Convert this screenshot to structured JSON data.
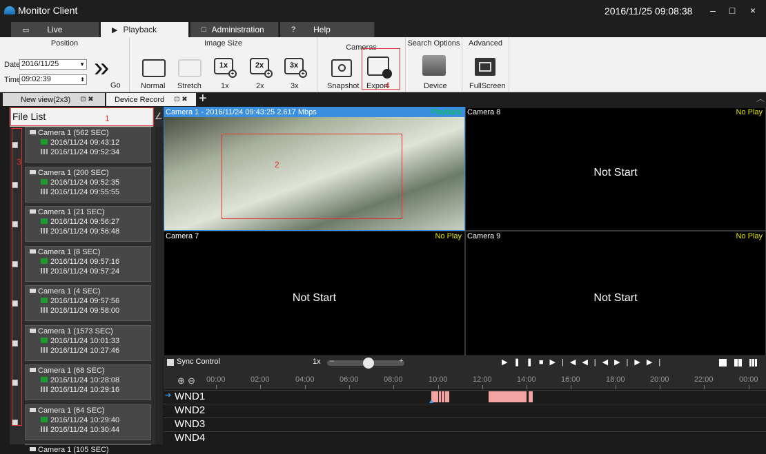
{
  "window": {
    "title": "Monitor Client",
    "datetime": "2016/11/25 09:08:38",
    "minimize": "–",
    "maximize": "□",
    "close": "×"
  },
  "main_tabs": [
    {
      "label": "Live"
    },
    {
      "label": "Playback"
    },
    {
      "label": "Administration"
    },
    {
      "label": "Help"
    }
  ],
  "ribbon": {
    "position": {
      "title": "Position",
      "date_label": "Date",
      "date_value": "2016/11/25",
      "time_label": "Time",
      "time_value": "09:02:39",
      "go_label": "Go"
    },
    "image_size": {
      "title": "Image Size",
      "normal": "Normal",
      "stretch": "Stretch",
      "z1": "1x",
      "z2": "2x",
      "z3": "3x"
    },
    "cameras": {
      "title": "Cameras",
      "snapshot": "Snapshot",
      "export": "Export"
    },
    "search": {
      "title": "Search Options",
      "device": "Device"
    },
    "advanced": {
      "title": "Advanced",
      "fullscreen": "FullScreen"
    }
  },
  "view_tabs": [
    {
      "label": "New view(2x3)"
    },
    {
      "label": "Device Record"
    }
  ],
  "file_list": {
    "title": "File List",
    "records": [
      {
        "title": "Camera 1  (562 SEC)",
        "start": "2016/11/24 09:43:12",
        "end": "2016/11/24 09:52:34"
      },
      {
        "title": "Camera 1  (200 SEC)",
        "start": "2016/11/24 09:52:35",
        "end": "2016/11/24 09:55:55"
      },
      {
        "title": "Camera 1  (21 SEC)",
        "start": "2016/11/24 09:56:27",
        "end": "2016/11/24 09:56:48"
      },
      {
        "title": "Camera 1  (8 SEC)",
        "start": "2016/11/24 09:57:16",
        "end": "2016/11/24 09:57:24"
      },
      {
        "title": "Camera 1  (4 SEC)",
        "start": "2016/11/24 09:57:56",
        "end": "2016/11/24 09:58:00"
      },
      {
        "title": "Camera 1  (1573 SEC)",
        "start": "2016/11/24 10:01:33",
        "end": "2016/11/24 10:27:46"
      },
      {
        "title": "Camera 1  (68 SEC)",
        "start": "2016/11/24 10:28:08",
        "end": "2016/11/24 10:29:16"
      },
      {
        "title": "Camera 1  (64 SEC)",
        "start": "2016/11/24 10:29:40",
        "end": "2016/11/24 10:30:44"
      },
      {
        "title": "Camera 1  (105 SEC)",
        "start": "",
        "end": ""
      }
    ]
  },
  "panes": [
    {
      "label": "Camera 1 - 2016/11/24 09:43:25 2.617 Mbps",
      "status": "Playback",
      "status_color": "#00cc44",
      "center": ""
    },
    {
      "label": "Camera 8",
      "status": "No Play",
      "status_color": "#e6e600",
      "center": "Not Start"
    },
    {
      "label": "Camera 7",
      "status": "No Play",
      "status_color": "#e6e600",
      "center": "Not Start"
    },
    {
      "label": "Camera 9",
      "status": "No Play",
      "status_color": "#e6e600",
      "center": "Not Start"
    }
  ],
  "annotations": [
    "1",
    "2",
    "3",
    "4"
  ],
  "controls": {
    "sync": "Sync Control",
    "speed": "1x",
    "minus": "–",
    "plus": "+"
  },
  "timeline": {
    "ticks": [
      "00:00",
      "02:00",
      "04:00",
      "06:00",
      "08:00",
      "10:00",
      "12:00",
      "14:00",
      "16:00",
      "18:00",
      "20:00",
      "22:00",
      "00:00"
    ],
    "rows": [
      {
        "label": "WND1"
      },
      {
        "label": "WND2"
      },
      {
        "label": "WND3"
      },
      {
        "label": "WND4"
      }
    ],
    "recording_color": "#f4a3a3"
  }
}
